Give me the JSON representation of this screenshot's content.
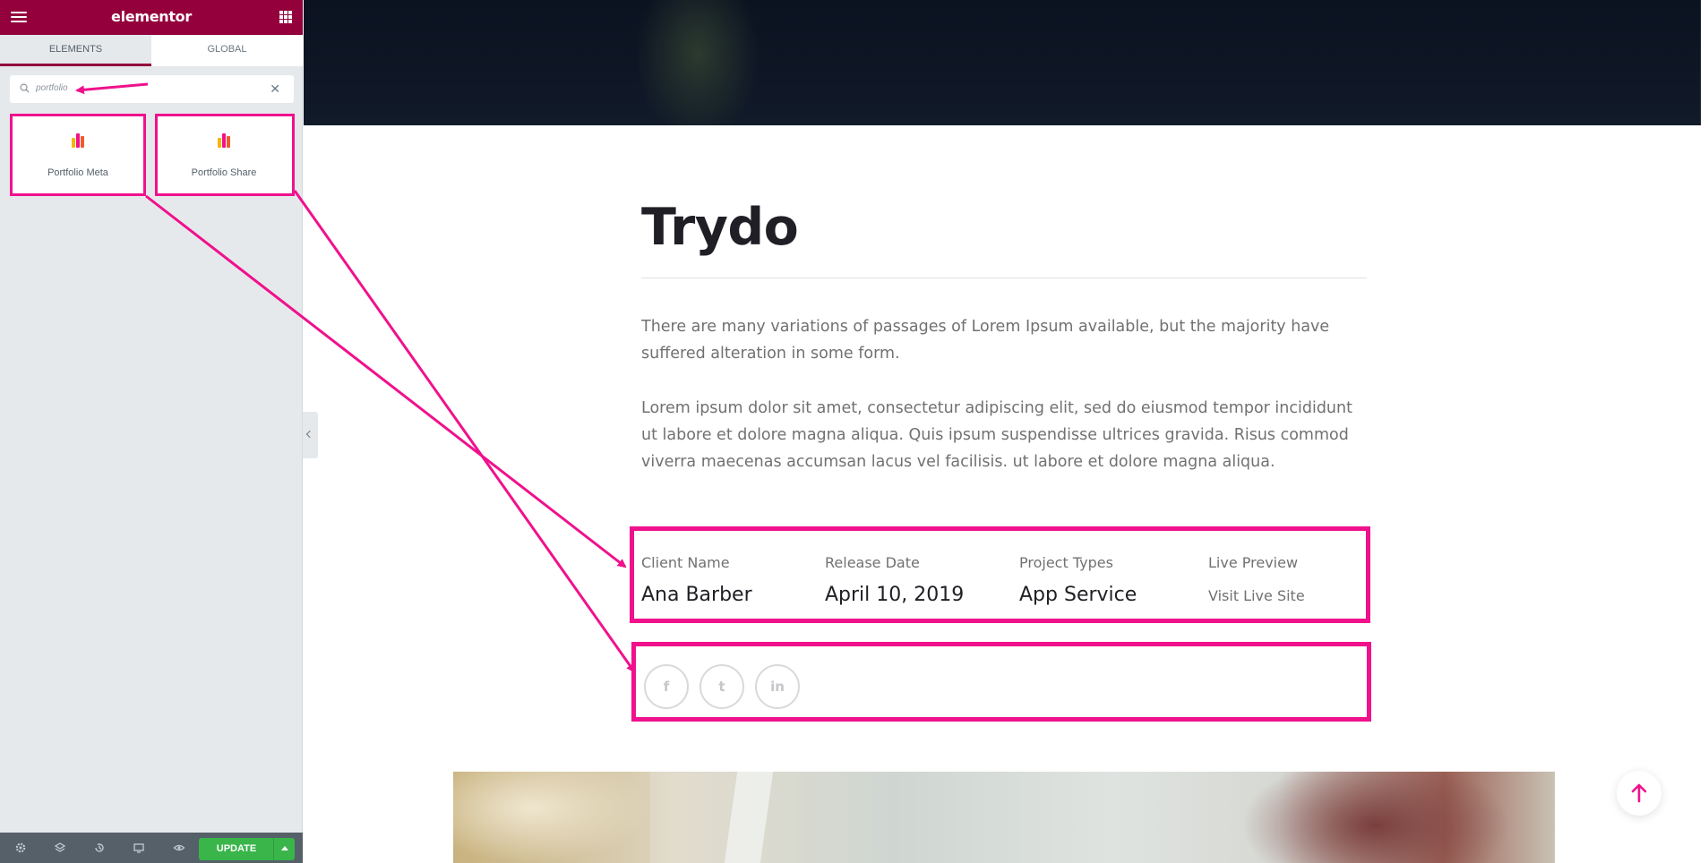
{
  "panel": {
    "logo": "elementor",
    "tabs": [
      {
        "label": "ELEMENTS",
        "active": true
      },
      {
        "label": "GLOBAL",
        "active": false
      }
    ],
    "search": {
      "value": "portfolio",
      "icon": "search-icon",
      "clear_icon": "close-icon"
    },
    "widgets": [
      {
        "label": "Portfolio Meta",
        "icon": "portfolio-widget-icon"
      },
      {
        "label": "Portfolio Share",
        "icon": "portfolio-widget-icon"
      }
    ],
    "footer": {
      "icons": [
        "gear-icon",
        "layers-icon",
        "history-icon",
        "desktop-icon",
        "eye-icon"
      ],
      "update_label": "UPDATE"
    }
  },
  "page": {
    "title": "Trydo",
    "paragraphs": [
      "There are many variations of passages of Lorem Ipsum available, but the majority have suffered alteration in some form.",
      "Lorem ipsum dolor sit amet, consectetur adipiscing elit, sed do eiusmod tempor incididunt ut labore et dolore magna aliqua. Quis ipsum suspendisse ultrices gravida. Risus commod viverra maecenas accumsan lacus vel facilisis. ut labore et dolore magna aliqua."
    ],
    "meta": [
      {
        "label": "Client Name",
        "value": "Ana Barber"
      },
      {
        "label": "Release Date",
        "value": "April 10, 2019"
      },
      {
        "label": "Project Types",
        "value": "App Service"
      },
      {
        "label": "Live Preview",
        "value": "Visit Live Site"
      }
    ],
    "share": [
      {
        "icon": "facebook-icon",
        "glyph": "f"
      },
      {
        "icon": "twitter-icon",
        "glyph": "t"
      },
      {
        "icon": "linkedin-icon",
        "glyph": "in"
      }
    ],
    "scroll_top_icon": "arrow-up-icon"
  },
  "colors": {
    "brand": "#93003c",
    "annotation": "#f0118c",
    "update_green": "#39b54a",
    "heading": "#1f1f25",
    "body_text": "#717173"
  }
}
